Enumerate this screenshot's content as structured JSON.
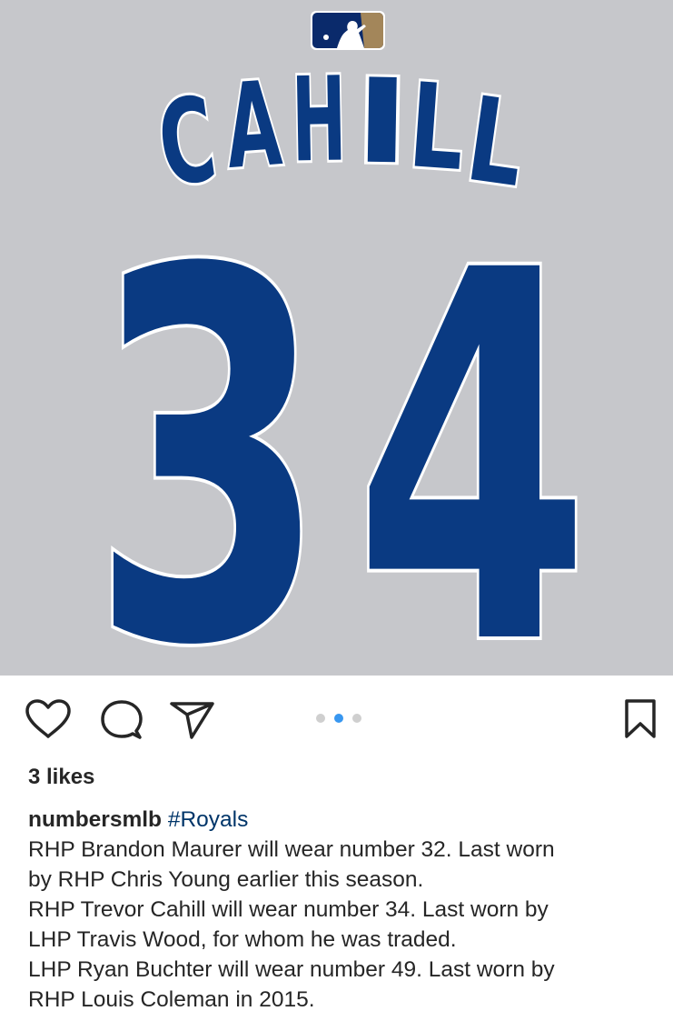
{
  "post": {
    "jersey_name": "CAHILL",
    "jersey_number": "34",
    "colors": {
      "background": "#c6c7cb",
      "royal_blue": "#0a3a82",
      "outline": "#ffffff",
      "mlb_blue": "#0a2a6b",
      "mlb_red": "#a3865a",
      "active_dot": "#3897f0",
      "hashtag": "#003569"
    },
    "icons": {
      "like": "heart-outline-icon",
      "comment": "comment-bubble-icon",
      "share": "paper-plane-icon",
      "save": "bookmark-icon",
      "logo": "mlb-logo-icon"
    },
    "carousel": {
      "total": 3,
      "active_index": 1
    },
    "likes_text": "3 likes",
    "username": "numbersmlb",
    "hashtag": "#Royals",
    "caption_lines": [
      "RHP Brandon Maurer will wear number 32. Last worn",
      "by RHP Chris Young earlier this season.",
      "RHP Trevor Cahill will wear number 34. Last worn by",
      "LHP Travis Wood, for whom he was traded.",
      "LHP Ryan Buchter will wear number 49. Last worn by",
      "RHP Louis Coleman in 2015."
    ]
  }
}
